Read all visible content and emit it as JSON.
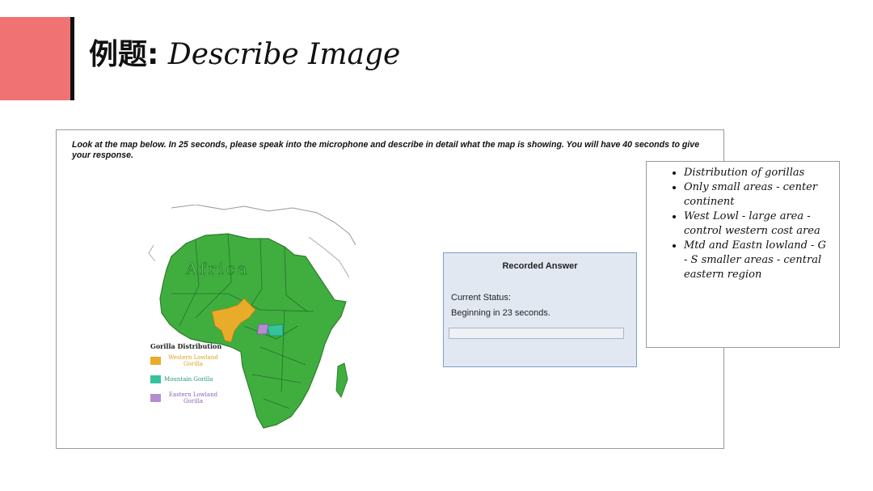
{
  "slide": {
    "title_zh": "例题:",
    "title_en": "Describe Image",
    "accent_color": "#f07272"
  },
  "task": {
    "instructions": "Look at the map below. In 25 seconds, please speak into the microphone and describe in detail what the map is showing. You will have 40 seconds to give your response."
  },
  "map": {
    "label": "Africa",
    "land_color": "#3fae3f",
    "legend_title": "Gorilla Distribution",
    "legend": [
      {
        "name": "western-lowland",
        "line1": "Western Lowland",
        "line2": "Gorilla",
        "color": "#e8ac2a"
      },
      {
        "name": "mountain",
        "line1": "Mountain Gorilla",
        "line2": "",
        "color": "#35c39c"
      },
      {
        "name": "eastern-lowland",
        "line1": "Eastern Lowland",
        "line2": "Gorilla",
        "color": "#b38dd0"
      }
    ]
  },
  "recorder": {
    "title": "Recorded Answer",
    "status_label": "Current Status:",
    "status_value": "Beginning in 23 seconds.",
    "progress": 0
  },
  "notes": {
    "items": [
      "Distribution of gorillas",
      "Only small areas - center continent",
      "West Lowl - large area - control western cost area",
      "Mtd and Eastn lowland - G - S smaller areas -  central eastern region"
    ]
  }
}
